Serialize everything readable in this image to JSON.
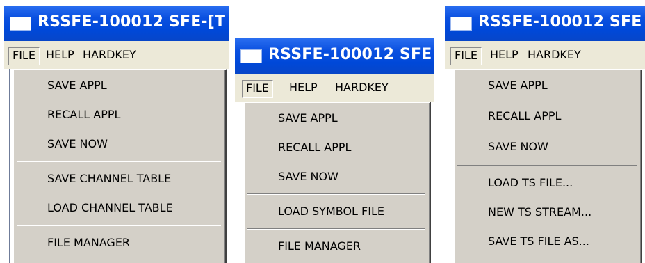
{
  "panels": [
    {
      "title": "RSSFE-100012  SFE-[T",
      "menubar": [
        "FILE",
        "HELP",
        "HARDKEY"
      ],
      "active_menu": "FILE",
      "menu_items": [
        {
          "label": "SAVE APPL"
        },
        {
          "label": "RECALL APPL"
        },
        {
          "label": "SAVE NOW"
        },
        {
          "separator": true
        },
        {
          "label": "SAVE CHANNEL TABLE"
        },
        {
          "label": "LOAD CHANNEL TABLE"
        },
        {
          "separator": true
        },
        {
          "label": "FILE MANAGER"
        }
      ]
    },
    {
      "title": "RSSFE-100012  SFE",
      "menubar": [
        "FILE",
        "HELP",
        "HARDKEY"
      ],
      "active_menu": "FILE",
      "menu_items": [
        {
          "label": "SAVE APPL"
        },
        {
          "label": "RECALL APPL"
        },
        {
          "label": "SAVE NOW"
        },
        {
          "separator": true
        },
        {
          "label": "LOAD SYMBOL FILE"
        },
        {
          "separator": true
        },
        {
          "label": "FILE MANAGER"
        }
      ]
    },
    {
      "title": "RSSFE-100012  SFE",
      "menubar": [
        "FILE",
        "HELP",
        "HARDKEY"
      ],
      "active_menu": "FILE",
      "menu_items": [
        {
          "label": "SAVE APPL"
        },
        {
          "label": "RECALL APPL"
        },
        {
          "label": "SAVE NOW"
        },
        {
          "separator": true
        },
        {
          "label": "LOAD TS FILE..."
        },
        {
          "label": "NEW TS STREAM..."
        },
        {
          "label": "SAVE TS FILE AS..."
        }
      ]
    }
  ]
}
